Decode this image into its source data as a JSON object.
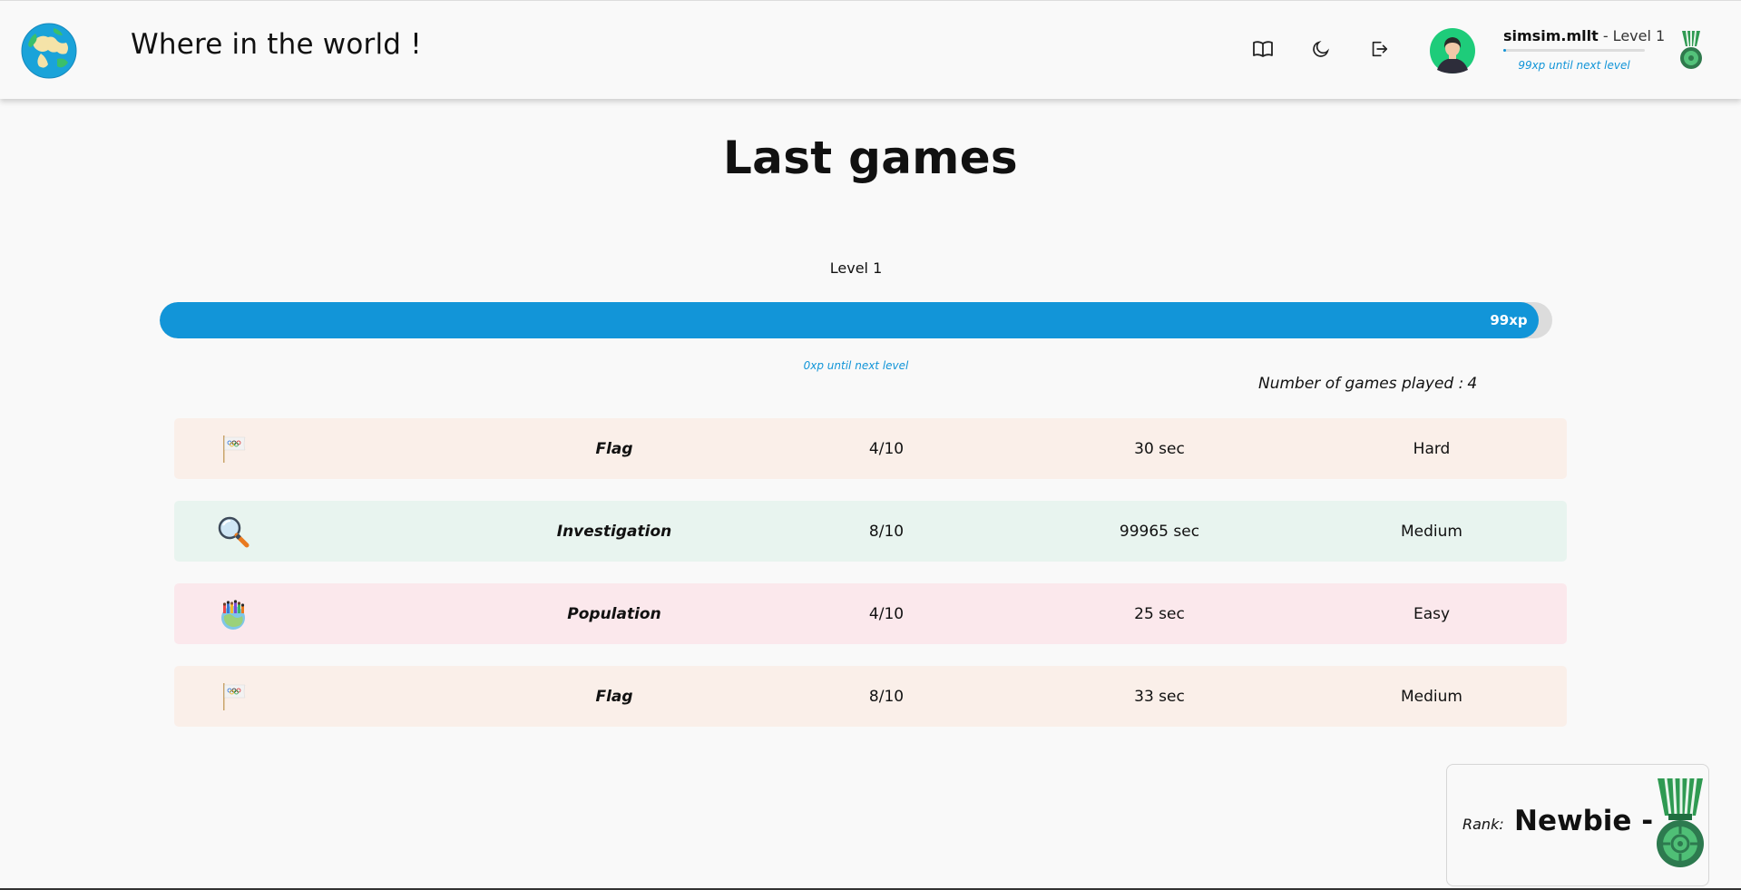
{
  "app": {
    "title": "Where in the world !"
  },
  "header": {
    "icons": [
      "book-icon",
      "moon-icon",
      "logout-icon"
    ],
    "user": {
      "name": "simsim.mllt",
      "level_text": " - Level 1",
      "xp_progress": 0.01,
      "xp_until_next": "99xp until next level"
    }
  },
  "main": {
    "title": "Last games",
    "level_label": "Level 1",
    "xp_bar": {
      "label": "99xp",
      "fill_fraction": 0.99
    },
    "next_level_text": "0xp until next level",
    "games_played_label": "Number of games played :",
    "games_played_count": "4"
  },
  "games": [
    {
      "icon": "olympic-flag-icon",
      "mode": "Flag",
      "score": "4/10",
      "time": "30 sec",
      "difficulty": "Hard",
      "color": "#faefe9"
    },
    {
      "icon": "magnifier-icon",
      "mode": "Investigation",
      "score": "8/10",
      "time": "99965 sec",
      "difficulty": "Medium",
      "color": "#e8f4ef"
    },
    {
      "icon": "population-globe-icon",
      "mode": "Population",
      "score": "4/10",
      "time": "25 sec",
      "difficulty": "Easy",
      "color": "#fbe8ec"
    },
    {
      "icon": "olympic-flag-icon",
      "mode": "Flag",
      "score": "8/10",
      "time": "33 sec",
      "difficulty": "Medium",
      "color": "#faefe9"
    }
  ],
  "rank": {
    "label": "Rank:",
    "value": "Newbie -",
    "icon": "medal-icon"
  },
  "colors": {
    "accent": "#1295d8",
    "background": "#f9f9f9"
  }
}
